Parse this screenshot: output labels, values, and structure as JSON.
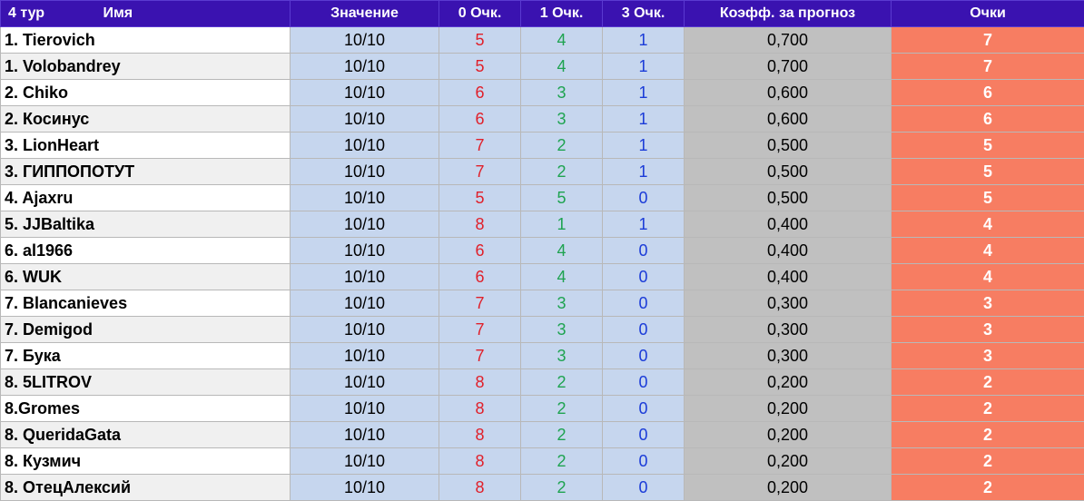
{
  "header": {
    "round": "4 тур",
    "name": "Имя",
    "value": "Значение",
    "zero": "0 Очк.",
    "one": "1 Очк.",
    "three": "3 Очк.",
    "coef": "Коэфф. за прогноз",
    "points": "Очки"
  },
  "rows": [
    {
      "name": "1. Tierovich",
      "value": "10/10",
      "zero": "5",
      "one": "4",
      "three": "1",
      "coef": "0,700",
      "points": "7"
    },
    {
      "name": "1. Volobandrey",
      "value": "10/10",
      "zero": "5",
      "one": "4",
      "three": "1",
      "coef": "0,700",
      "points": "7"
    },
    {
      "name": "2. Chiko",
      "value": "10/10",
      "zero": "6",
      "one": "3",
      "three": "1",
      "coef": "0,600",
      "points": "6"
    },
    {
      "name": "2. Косинус",
      "value": "10/10",
      "zero": "6",
      "one": "3",
      "three": "1",
      "coef": "0,600",
      "points": "6"
    },
    {
      "name": "3. LionHeart",
      "value": "10/10",
      "zero": "7",
      "one": "2",
      "three": "1",
      "coef": "0,500",
      "points": "5"
    },
    {
      "name": "3. ГИППОПОТУТ",
      "value": "10/10",
      "zero": "7",
      "one": "2",
      "three": "1",
      "coef": "0,500",
      "points": "5"
    },
    {
      "name": "4. Ajaxru",
      "value": "10/10",
      "zero": "5",
      "one": "5",
      "three": "0",
      "coef": "0,500",
      "points": "5"
    },
    {
      "name": "5. JJBaltika",
      "value": "10/10",
      "zero": "8",
      "one": "1",
      "three": "1",
      "coef": "0,400",
      "points": "4"
    },
    {
      "name": "6. al1966",
      "value": "10/10",
      "zero": "6",
      "one": "4",
      "three": "0",
      "coef": "0,400",
      "points": "4"
    },
    {
      "name": "6. WUK",
      "value": "10/10",
      "zero": "6",
      "one": "4",
      "three": "0",
      "coef": "0,400",
      "points": "4"
    },
    {
      "name": "7. Blancanieves",
      "value": "10/10",
      "zero": "7",
      "one": "3",
      "three": "0",
      "coef": "0,300",
      "points": "3"
    },
    {
      "name": "7. Demigod",
      "value": "10/10",
      "zero": "7",
      "one": "3",
      "three": "0",
      "coef": "0,300",
      "points": "3"
    },
    {
      "name": "7. Бука",
      "value": "10/10",
      "zero": "7",
      "one": "3",
      "three": "0",
      "coef": "0,300",
      "points": "3"
    },
    {
      "name": "8. 5LITROV",
      "value": "10/10",
      "zero": "8",
      "one": "2",
      "three": "0",
      "coef": "0,200",
      "points": "2"
    },
    {
      "name": "8.Gromes",
      "value": "10/10",
      "zero": "8",
      "one": "2",
      "three": "0",
      "coef": "0,200",
      "points": "2"
    },
    {
      "name": "8. QueridaGata",
      "value": "10/10",
      "zero": "8",
      "one": "2",
      "three": "0",
      "coef": "0,200",
      "points": "2"
    },
    {
      "name": "8. Кузмич",
      "value": "10/10",
      "zero": "8",
      "one": "2",
      "three": "0",
      "coef": "0,200",
      "points": "2"
    },
    {
      "name": "8. ОтецАлексий",
      "value": "10/10",
      "zero": "8",
      "one": "2",
      "three": "0",
      "coef": "0,200",
      "points": "2"
    }
  ]
}
